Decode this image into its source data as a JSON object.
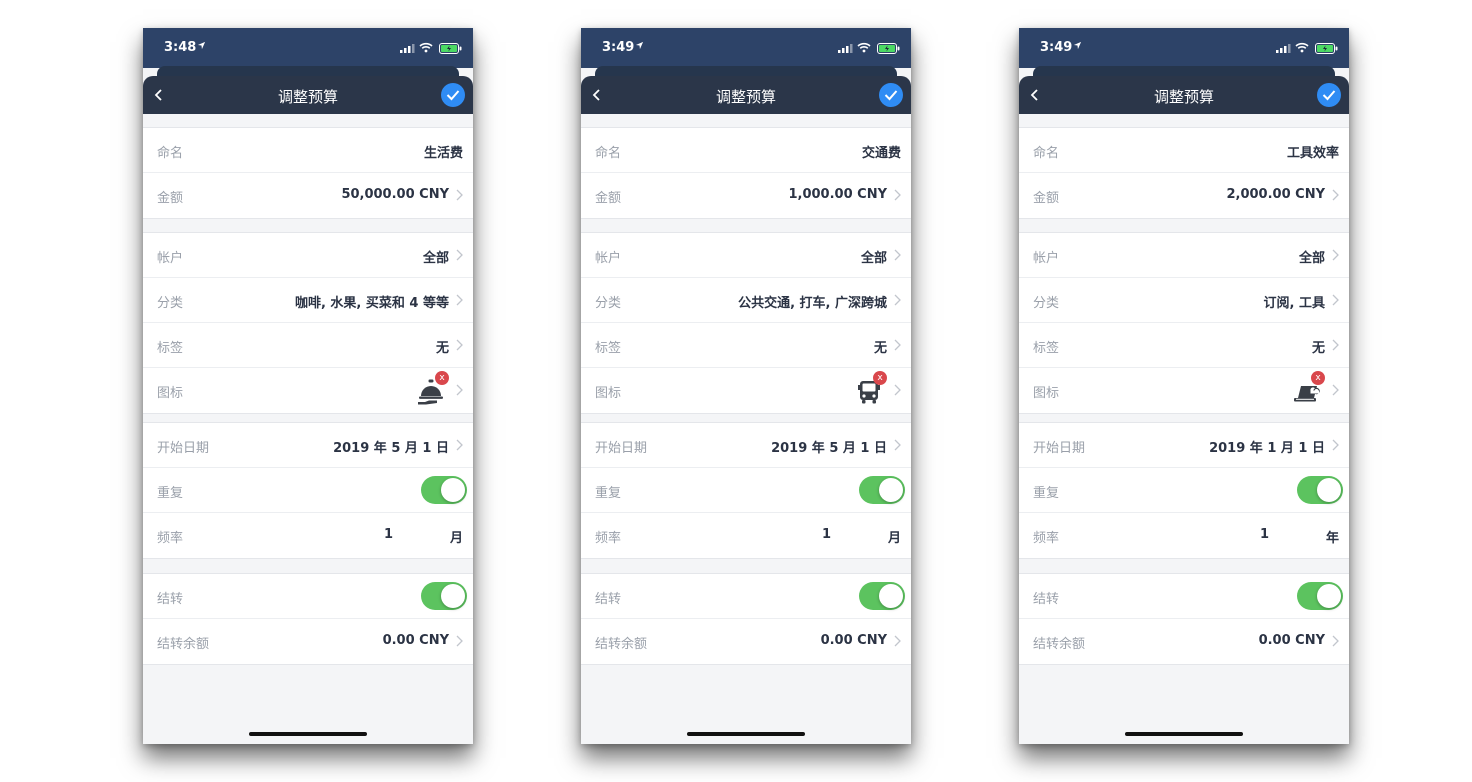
{
  "phones": [
    {
      "time": "3:48",
      "title": "调整预算",
      "rows": {
        "name": {
          "label": "命名",
          "value": "生活费"
        },
        "amount": {
          "label": "金额",
          "value": "50,000.00 CNY"
        },
        "account": {
          "label": "帐户",
          "value": "全部"
        },
        "category": {
          "label": "分类",
          "value": "咖啡, 水果, 买菜和 4 等等"
        },
        "tag": {
          "label": "标签",
          "value": "无"
        },
        "icon": {
          "label": "图标",
          "icon_name": "service-bell-icon"
        },
        "start_date": {
          "label": "开始日期",
          "value": "2019 年 5 月 1 日"
        },
        "repeat": {
          "label": "重复",
          "on": true
        },
        "frequency": {
          "label": "频率",
          "number": "1",
          "unit": "月"
        },
        "carryover": {
          "label": "结转",
          "on": true
        },
        "carryover_balance": {
          "label": "结转余额",
          "value": "0.00 CNY"
        }
      }
    },
    {
      "time": "3:49",
      "title": "调整预算",
      "rows": {
        "name": {
          "label": "命名",
          "value": "交通费"
        },
        "amount": {
          "label": "金额",
          "value": "1,000.00 CNY"
        },
        "account": {
          "label": "帐户",
          "value": "全部"
        },
        "category": {
          "label": "分类",
          "value": "公共交通, 打车, 广深跨城"
        },
        "tag": {
          "label": "标签",
          "value": "无"
        },
        "icon": {
          "label": "图标",
          "icon_name": "bus-icon"
        },
        "start_date": {
          "label": "开始日期",
          "value": "2019 年 5 月 1 日"
        },
        "repeat": {
          "label": "重复",
          "on": true
        },
        "frequency": {
          "label": "频率",
          "number": "1",
          "unit": "月"
        },
        "carryover": {
          "label": "结转",
          "on": true
        },
        "carryover_balance": {
          "label": "结转余额",
          "value": "0.00 CNY"
        }
      }
    },
    {
      "time": "3:49",
      "title": "调整预算",
      "rows": {
        "name": {
          "label": "命名",
          "value": "工具效率"
        },
        "amount": {
          "label": "金额",
          "value": "2,000.00 CNY"
        },
        "account": {
          "label": "帐户",
          "value": "全部"
        },
        "category": {
          "label": "分类",
          "value": "订阅, 工具"
        },
        "tag": {
          "label": "标签",
          "value": "无"
        },
        "icon": {
          "label": "图标",
          "icon_name": "laptop-cloud-icon"
        },
        "start_date": {
          "label": "开始日期",
          "value": "2019 年 1 月 1 日"
        },
        "repeat": {
          "label": "重复",
          "on": true
        },
        "frequency": {
          "label": "频率",
          "number": "1",
          "unit": "年"
        },
        "carryover": {
          "label": "结转",
          "on": true
        },
        "carryover_balance": {
          "label": "结转余额",
          "value": "0.00 CNY"
        }
      }
    }
  ],
  "icon_delete_glyph": "x",
  "colors": {
    "header": "#2d4368",
    "navbar": "#2b3649",
    "accent": "#2f8cf4",
    "toggle_on": "#5cc35f",
    "badge": "#d9474c"
  }
}
